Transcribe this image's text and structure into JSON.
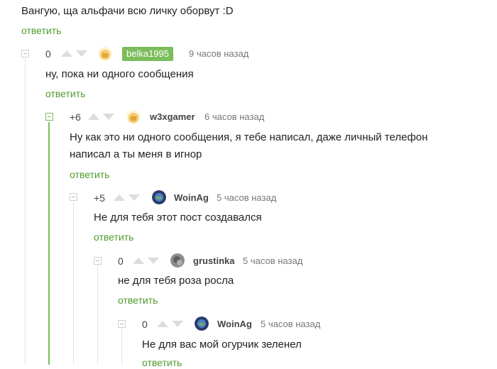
{
  "top_comment": {
    "text": "Вангую, ща альфачи всю личку оборвут :D",
    "reply": "ответить"
  },
  "comments": [
    {
      "score": "0",
      "user": "belka1995",
      "time": "9 часов назад",
      "lines": [
        "ну, пока ни одного сообщения"
      ],
      "reply": "ответить"
    },
    {
      "score": "+6",
      "user": "w3xgamer",
      "time": "6 часов назад",
      "lines": [
        "Ну как это ни одного сообщения, я тебе написал, даже личный телефон",
        "написал а ты меня в игнор"
      ],
      "reply": "ответить"
    },
    {
      "score": "+5",
      "user": "WoinAg",
      "time": "5 часов назад",
      "lines": [
        "Не для тебя этот пост создавался"
      ],
      "reply": "ответить"
    },
    {
      "score": "0",
      "user": "grustinka",
      "time": "5 часов назад",
      "lines": [
        "не для тебя роза росла"
      ],
      "reply": "ответить"
    },
    {
      "score": "0",
      "user": "WoinAg",
      "time": "5 часов назад",
      "lines": [
        "Не для вас мой огурчик зеленел"
      ],
      "reply": "ответить"
    }
  ],
  "colors": {
    "accent": "#7bbd5c",
    "reply_link": "#4f9b2f",
    "muted": "#dcdcdc"
  },
  "icons": [
    "collapse-icon",
    "upvote-icon",
    "downvote-icon"
  ]
}
